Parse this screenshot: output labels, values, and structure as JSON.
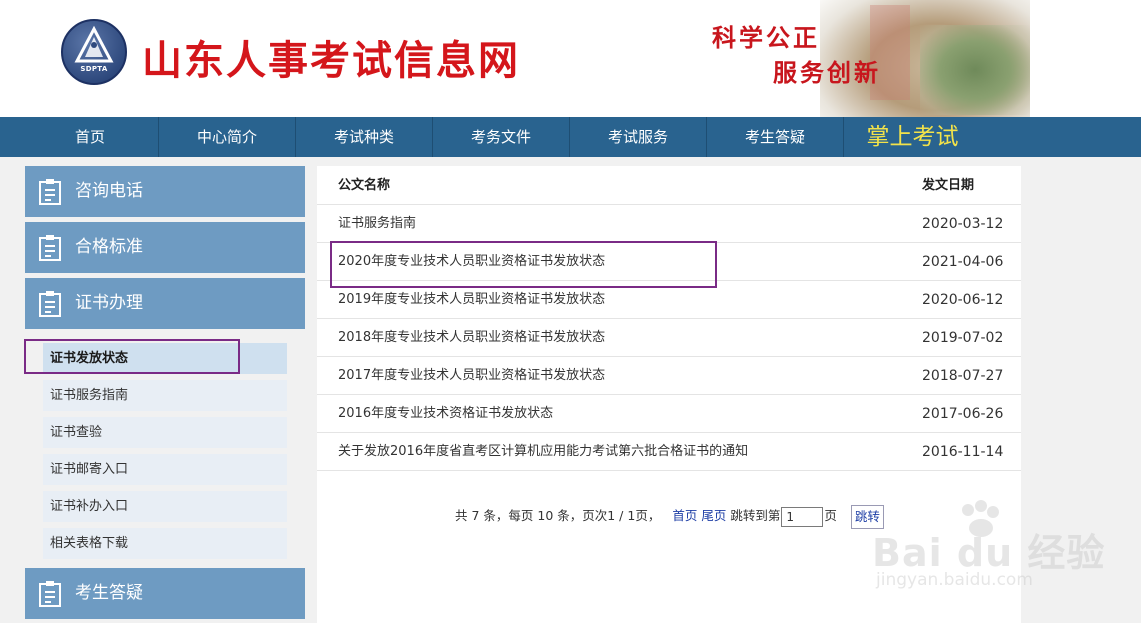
{
  "header": {
    "logo_text": "SDPTA",
    "site_title": "山东人事考试信息网",
    "slogan_line1": "科学公正",
    "slogan_line2": "服务创新"
  },
  "nav": {
    "items": [
      "首页",
      "中心简介",
      "考试种类",
      "考务文件",
      "考试服务",
      "考生答疑"
    ],
    "highlight": "掌上考试"
  },
  "sidebar": {
    "sections": [
      "咨询电话",
      "合格标准",
      "证书办理",
      "考生答疑"
    ],
    "sub_items": [
      "证书发放状态",
      "证书服务指南",
      "证书查验",
      "证书邮寄入口",
      "证书补办入口",
      "相关表格下载"
    ],
    "active_index": 0
  },
  "table": {
    "col_name": "公文名称",
    "col_date": "发文日期",
    "rows": [
      {
        "title": "证书服务指南",
        "date": "2020-03-12"
      },
      {
        "title": "2020年度专业技术人员职业资格证书发放状态",
        "date": "2021-04-06"
      },
      {
        "title": "2019年度专业技术人员职业资格证书发放状态",
        "date": "2020-06-12"
      },
      {
        "title": "2018年度专业技术人员职业资格证书发放状态",
        "date": "2019-07-02"
      },
      {
        "title": "2017年度专业技术人员职业资格证书发放状态",
        "date": "2018-07-27"
      },
      {
        "title": "2016年度专业技术资格证书发放状态",
        "date": "2017-06-26"
      },
      {
        "title": "关于发放2016年度省直考区计算机应用能力考试第六批合格证书的通知",
        "date": "2016-11-14"
      }
    ]
  },
  "pager": {
    "summary": "共 7 条，每页 10 条，页次1 / 1页，",
    "first": "首页",
    "last": "尾页",
    "jump_prefix": "跳转到第",
    "jump_value": "1",
    "jump_suffix": "页",
    "jump_button": "跳转"
  },
  "watermark": {
    "main": "Bai du 经验",
    "sub": "jingyan.baidu.com"
  },
  "colors": {
    "nav_bg": "#29638f",
    "sidebar_head_bg": "#6e9bc2",
    "title_red": "#d4161b",
    "highlight_yellow": "#f2e24a",
    "annotation_purple": "#7a2b86"
  }
}
